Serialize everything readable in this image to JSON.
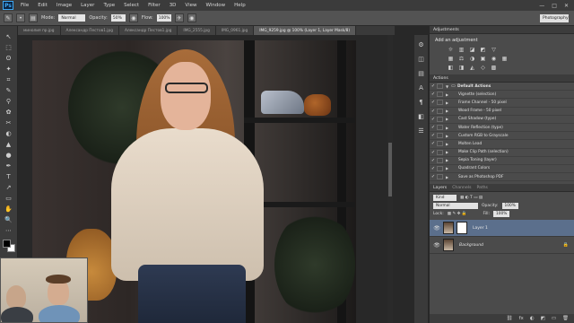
{
  "app": {
    "logo": "Ps"
  },
  "menu": [
    "File",
    "Edit",
    "Image",
    "Layer",
    "Type",
    "Select",
    "Filter",
    "3D",
    "View",
    "Window",
    "Help"
  ],
  "window_controls": {
    "minimize": "—",
    "restore": "□",
    "close": "✕"
  },
  "options": {
    "mode_label": "Mode:",
    "mode_value": "Normal",
    "opacity_label": "Opacity:",
    "opacity_value": "50%",
    "flow_label": "Flow:",
    "flow_value": "100%",
    "workspace": "Photography"
  },
  "tabs": [
    {
      "label": "минолия пр.jpg",
      "active": false
    },
    {
      "label": "Александр Пестов1.jpg",
      "active": false
    },
    {
      "label": "Александр Пестов1.jpg",
      "active": false
    },
    {
      "label": "IMG_2555.jpg",
      "active": false
    },
    {
      "label": "IMG_0961.jpg",
      "active": false
    },
    {
      "label": "IMG_9259.jpg @ 100% (Layer 1, Layer Mask/8)",
      "active": true
    }
  ],
  "tools": [
    "↖",
    "⬚",
    "ʘ",
    "✦",
    "⌗",
    "✎",
    "⚲",
    "✿",
    "✂",
    "◐",
    "▲",
    "●",
    "✒",
    "T",
    "↗",
    "▭",
    "✋",
    "🔍",
    "⋯"
  ],
  "right_icons": [
    "⚙",
    "◫",
    "▤",
    "A",
    "¶",
    "◧",
    "☰"
  ],
  "adjustments": {
    "tab": "Adjustments",
    "title": "Add an adjustment",
    "row1": [
      "☼",
      "▥",
      "◪",
      "◩",
      "▽"
    ],
    "row2": [
      "▦",
      "⚖",
      "◑",
      "▣",
      "◉",
      "▦"
    ],
    "row3": [
      "◧",
      "◨",
      "◭",
      "◇",
      "▩"
    ]
  },
  "actions": {
    "tab": "Actions",
    "set_name": "Default Actions",
    "items": [
      "Vignette (selection)",
      "Frame Channel - 50 pixel",
      "Wood Frame - 50 pixel",
      "Cast Shadow (type)",
      "Water Reflection (type)",
      "Custom RGB to Grayscale",
      "Molten Lead",
      "Make Clip Path (selection)",
      "Sepia Toning (layer)",
      "Quadrant Colors",
      "Save as Photoshop PDF"
    ]
  },
  "layers": {
    "tabs": [
      "Layers",
      "Channels",
      "Paths"
    ],
    "kind_label": "Kind",
    "blend_mode": "Normal",
    "opacity_label": "Opacity:",
    "opacity_value": "100%",
    "lock_label": "Lock:",
    "fill_label": "Fill:",
    "fill_value": "100%",
    "items": [
      {
        "name": "Layer 1",
        "selected": true,
        "italic": false
      },
      {
        "name": "Background",
        "selected": false,
        "italic": true
      }
    ],
    "footer_icons": [
      "⛓",
      "fx",
      "◐",
      "◩",
      "▭",
      "🗑"
    ]
  }
}
